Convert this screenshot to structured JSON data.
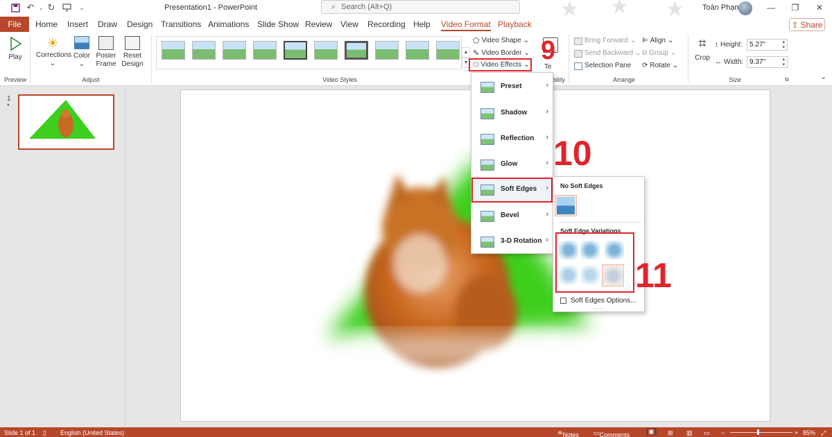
{
  "titlebar": {
    "document_title": "Presentation1  -  PowerPoint",
    "search_placeholder": "Search (Alt+Q)",
    "user_name": "Toàn Phạm",
    "qat_icons": [
      "save-icon",
      "undo-icon",
      "redo-icon",
      "present-icon",
      "customize-icon"
    ]
  },
  "tabs": [
    {
      "label": "File"
    },
    {
      "label": "Home"
    },
    {
      "label": "Insert"
    },
    {
      "label": "Draw"
    },
    {
      "label": "Design"
    },
    {
      "label": "Transitions"
    },
    {
      "label": "Animations"
    },
    {
      "label": "Slide Show"
    },
    {
      "label": "Review"
    },
    {
      "label": "View"
    },
    {
      "label": "Recording"
    },
    {
      "label": "Help"
    },
    {
      "label": "Video Format"
    },
    {
      "label": "Playback"
    }
  ],
  "share_label": "Share",
  "ribbon": {
    "preview": {
      "play_label": "Play",
      "group": "Preview"
    },
    "adjust": {
      "corrections": "Corrections",
      "color": "Color",
      "poster_frame": "Poster Frame",
      "reset_design": "Reset Design",
      "group": "Adjust"
    },
    "video_styles": {
      "group": "Video Styles",
      "video_shape": "Video Shape",
      "video_border": "Video Border",
      "video_effects": "Video Effects"
    },
    "accessibility": {
      "partial_label": "Te",
      "group_partial": "ibility"
    },
    "arrange": {
      "bring_forward": "Bring Forward",
      "send_backward": "Send Backward",
      "selection_pane": "Selection Pane",
      "align": "Align",
      "group_btn": "Group",
      "rotate": "Rotate",
      "group": "Arrange"
    },
    "size": {
      "crop": "Crop",
      "height_label": "Height:",
      "height_value": "5.27\"",
      "width_label": "Width:",
      "width_value": "9.37\"",
      "group": "Size"
    }
  },
  "slide_pane": {
    "slide_number": "1",
    "star": "*"
  },
  "video_effects_menu": {
    "items": [
      {
        "label": "Preset"
      },
      {
        "label": "Shadow"
      },
      {
        "label": "Reflection"
      },
      {
        "label": "Glow"
      },
      {
        "label": "Soft Edges"
      },
      {
        "label": "Bevel"
      },
      {
        "label": "3-D Rotation"
      }
    ]
  },
  "soft_edges_submenu": {
    "no_soft_edges": "No Soft Edges",
    "variations": "Soft Edge Variations",
    "options": "Soft Edges Options..."
  },
  "annotations": {
    "step9": "9",
    "step10": "10",
    "step11": "11"
  },
  "statusbar": {
    "slide_info": "Slide 1 of 1",
    "language": "English (United States)",
    "notes": "Notes",
    "comments": "Comments",
    "zoom": "85%"
  },
  "colors": {
    "accent": "#b7472a",
    "highlight": "#e0242b",
    "slide_green": "#3ecf1e"
  }
}
